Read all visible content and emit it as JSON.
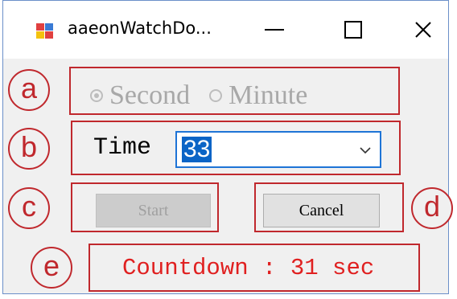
{
  "window": {
    "title": "aaeonWatchDo...",
    "minimize_glyph": "—",
    "maximize_glyph": "☐",
    "close_glyph": "✕"
  },
  "unit_group": {
    "options": [
      {
        "label": "Second",
        "checked": true
      },
      {
        "label": "Minute",
        "checked": false
      }
    ],
    "enabled": false
  },
  "time": {
    "label": "Time",
    "value": "33"
  },
  "buttons": {
    "start_label": "Start",
    "cancel_label": "Cancel"
  },
  "status": {
    "countdown_text": "Countdown : 31 sec"
  },
  "annotations": {
    "a": "a",
    "b": "b",
    "c": "c",
    "d": "d",
    "e": "e"
  },
  "colors": {
    "annotation_red": "#c0282d",
    "countdown_red": "#e02020",
    "selection_blue": "#0a64c6",
    "focus_border": "#1e74d6"
  }
}
